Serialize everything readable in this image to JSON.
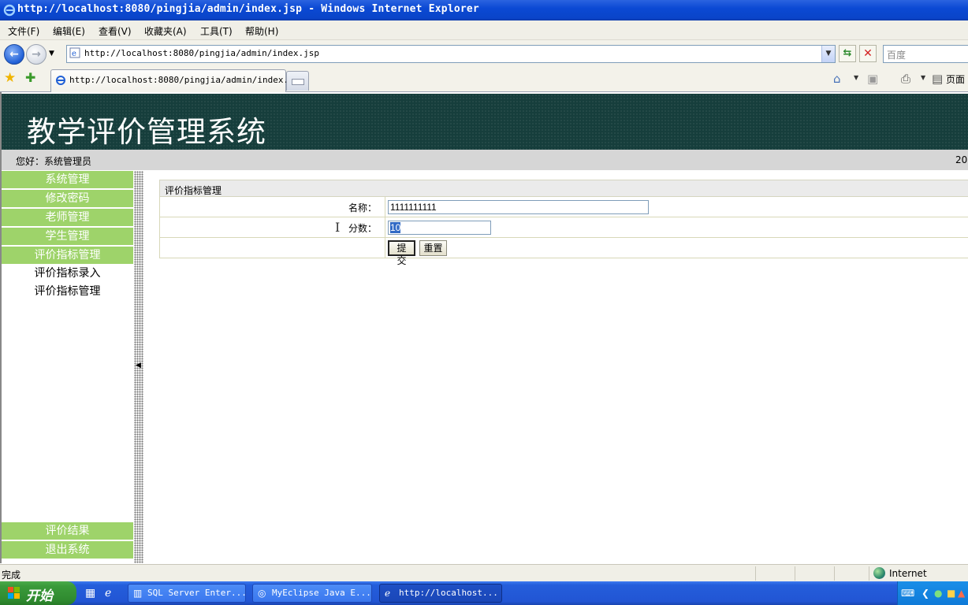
{
  "window": {
    "title": "http://localhost:8080/pingjia/admin/index.jsp - Windows Internet Explorer"
  },
  "menu": {
    "items": [
      "文件(F)",
      "编辑(E)",
      "查看(V)",
      "收藏夹(A)",
      "工具(T)",
      "帮助(H)"
    ]
  },
  "address": {
    "url": "http://localhost:8080/pingjia/admin/index.jsp",
    "search_placeholder": "百度"
  },
  "tabs": {
    "active_label": "http://localhost:8080/pingjia/admin/index...",
    "page_menu": "页面"
  },
  "app": {
    "title": "教学评价管理系统",
    "greeting": "您好：系统管理员",
    "date_fragment": "20"
  },
  "sidebar": {
    "items": [
      "系统管理",
      "修改密码",
      "老师管理",
      "学生管理",
      "评价指标管理"
    ],
    "subitems": [
      "评价指标录入",
      "评价指标管理"
    ],
    "bottom_items": [
      "评价结果",
      "退出系统"
    ]
  },
  "form": {
    "title": "评价指标管理",
    "name_label": "名称：",
    "name_value": "1111111111",
    "score_label": "分数：",
    "score_value": "10",
    "submit_label": "提交",
    "reset_label": "重置"
  },
  "status": {
    "text": "完成",
    "zone": "Internet"
  },
  "taskbar": {
    "start_label": "开始",
    "tasks": [
      "SQL Server Enter...",
      "MyEclipse Java E...",
      "http://localhost..."
    ]
  },
  "colors": {
    "banner": "#163e3c",
    "sidebar_green": "#9ed36a",
    "selection": "#316ac5"
  }
}
